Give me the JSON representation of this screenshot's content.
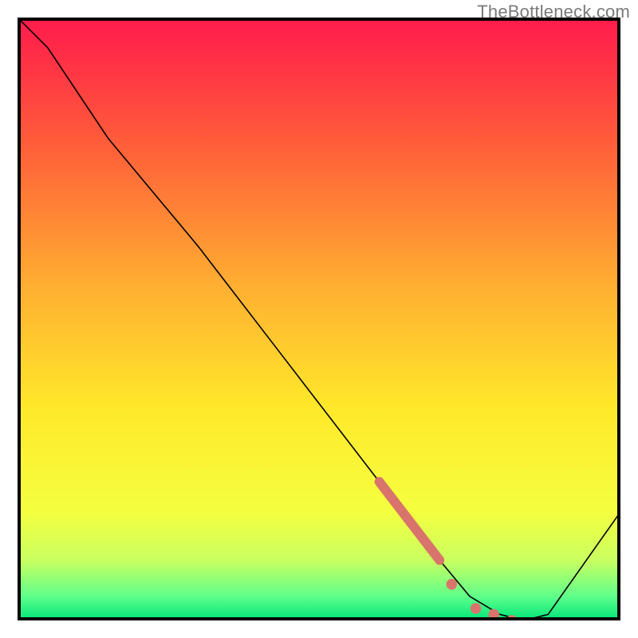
{
  "watermark": "TheBottleneck.com",
  "colors": {
    "gradient_stops": [
      {
        "pct": 0,
        "hex": "#ff1a4d"
      },
      {
        "pct": 20,
        "hex": "#ff5a3a"
      },
      {
        "pct": 45,
        "hex": "#ffb031"
      },
      {
        "pct": 65,
        "hex": "#ffe92a"
      },
      {
        "pct": 82,
        "hex": "#f4ff40"
      },
      {
        "pct": 90,
        "hex": "#c9ff60"
      },
      {
        "pct": 96,
        "hex": "#5fff8a"
      },
      {
        "pct": 100,
        "hex": "#00e57a"
      }
    ],
    "highlight": "#d9746c",
    "curve": "#000000",
    "border": "#000000"
  },
  "chart_data": {
    "type": "line",
    "title": "",
    "xlabel": "",
    "ylabel": "",
    "xlim": [
      0,
      100
    ],
    "ylim": [
      0,
      100
    ],
    "grid": false,
    "legend": false,
    "x": [
      0,
      5,
      15,
      25,
      30,
      40,
      50,
      60,
      65,
      70,
      75,
      80,
      84,
      88,
      100
    ],
    "values": [
      100,
      95,
      80,
      68,
      62,
      49,
      36,
      23,
      17,
      10,
      4,
      1,
      0,
      1,
      18
    ],
    "highlight_segment": {
      "type": "line",
      "x": [
        60,
        70
      ],
      "values": [
        23,
        10
      ]
    },
    "highlight_points": {
      "x": [
        72,
        76,
        79,
        82
      ],
      "values": [
        6,
        2,
        1,
        0
      ]
    }
  }
}
